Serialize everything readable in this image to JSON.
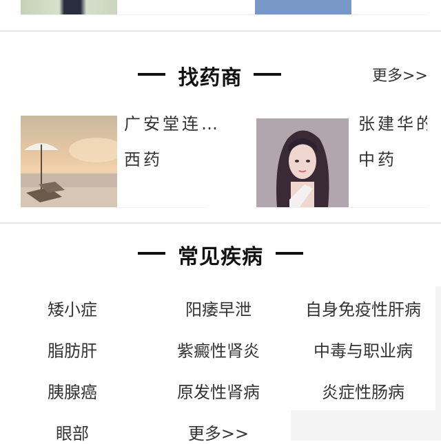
{
  "merchants": {
    "title": "找药商",
    "more": "更多>>",
    "items": [
      {
        "name": "广安堂连…",
        "category": "西药"
      },
      {
        "name": "张建华的",
        "category": "中药"
      }
    ]
  },
  "diseases": {
    "title": "常见疾病",
    "items": [
      "矮小症",
      "阳痿早泄",
      "自身免疫性肝病",
      "脂肪肝",
      "紫癜性肾炎",
      "中毒与职业病",
      "胰腺癌",
      "原发性肾病",
      "炎症性肠病",
      "眼部"
    ],
    "more": "更多>>"
  }
}
